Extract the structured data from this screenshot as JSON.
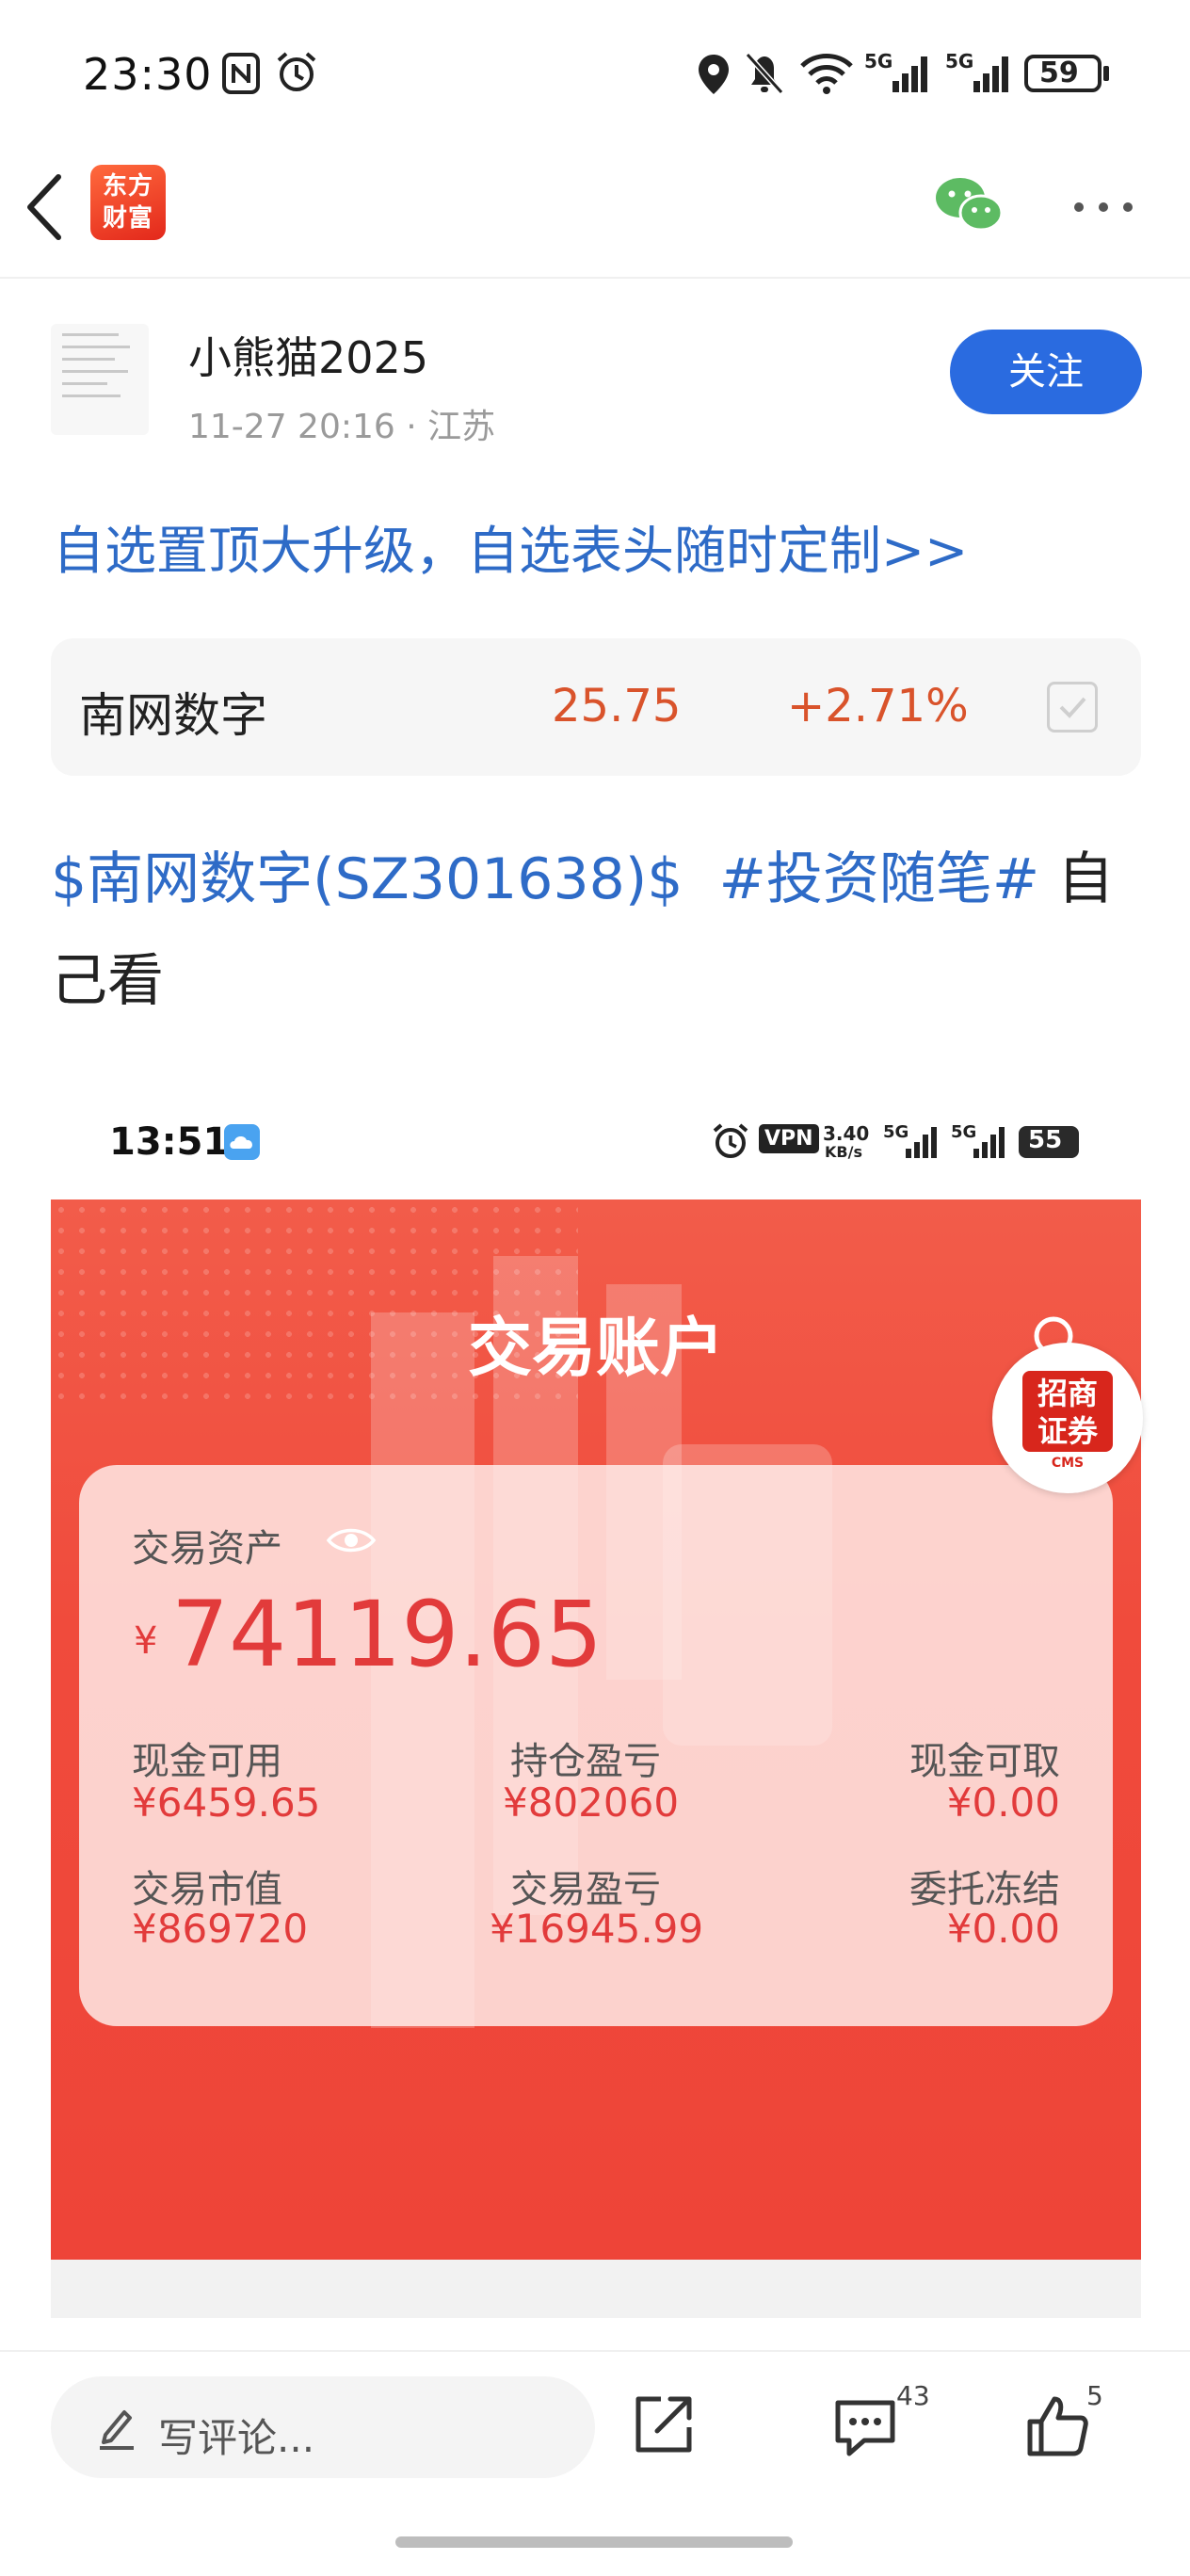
{
  "status_bar": {
    "time": "23:30",
    "battery": "59"
  },
  "nav": {
    "logo_line1": "东方",
    "logo_line2": "财富"
  },
  "author": {
    "name": "小熊猫2025",
    "meta": "11-27 20:16 · 江苏",
    "follow_label": "关注"
  },
  "promo_link": "自选置顶大升级，自选表头随时定制>>",
  "stock": {
    "name": "南网数字",
    "price": "25.75",
    "change": "+2.71%"
  },
  "post": {
    "stock_tag": "$南网数字(SZ301638)$",
    "topic_tag": "#投资随笔#",
    "text": " 自己看"
  },
  "screenshot": {
    "status": {
      "time": "13:51",
      "vpn": "VPN",
      "speed_top": "3.40",
      "speed_bottom": "KB/s",
      "net1": "5G",
      "net2": "5G",
      "battery": "55"
    },
    "title": "交易账户",
    "badge_line1": "招商",
    "badge_line2": "证券",
    "badge_sub": "CMS",
    "asset_label": "交易资产",
    "currency": "¥",
    "asset_value": "74119.65",
    "stats": [
      {
        "label": "现金可用",
        "value": "¥6459.65"
      },
      {
        "label": "持仓盈亏",
        "value": "¥802060"
      },
      {
        "label": "现金可取",
        "value": "¥0.00"
      },
      {
        "label": "交易市值",
        "value": "¥869720"
      },
      {
        "label": "交易盈亏",
        "value": "¥16945.99"
      },
      {
        "label": "委托冻结",
        "value": "¥0.00"
      }
    ]
  },
  "bottom": {
    "comment_placeholder": "写评论...",
    "comment_count": "43",
    "like_count": "5"
  },
  "colors": {
    "accent_blue": "#2a6be0",
    "link_blue": "#2e6bc7",
    "up_red": "#d9532b",
    "panel_red": "#f04b3c"
  }
}
